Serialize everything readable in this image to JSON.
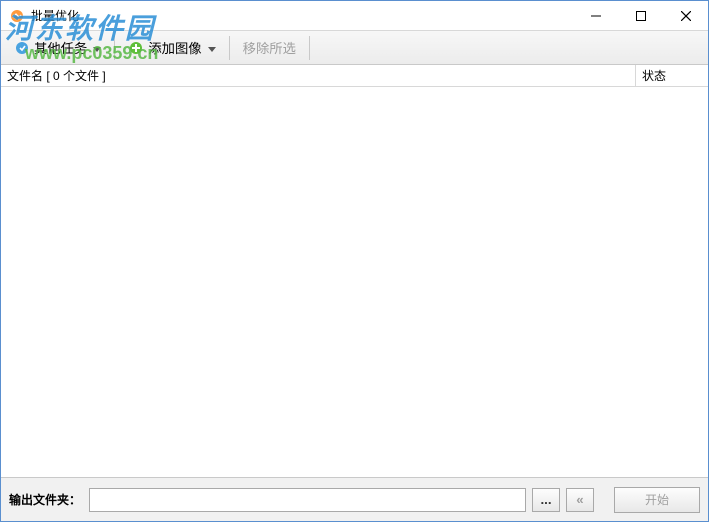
{
  "window": {
    "title": "批量优化"
  },
  "toolbar": {
    "other_tasks": "其他任务",
    "add_image": "添加图像",
    "remove_selected": "移除所选"
  },
  "columns": {
    "filename_label": "文件名 [ 0 个文件 ]",
    "status_label": "状态"
  },
  "bottom": {
    "output_label": "输出文件夹：",
    "output_value": "",
    "browse": "...",
    "collapse": "«",
    "start": "开始"
  },
  "watermark": {
    "cn": "河东软件园",
    "url": "www.pc0359.cn"
  }
}
